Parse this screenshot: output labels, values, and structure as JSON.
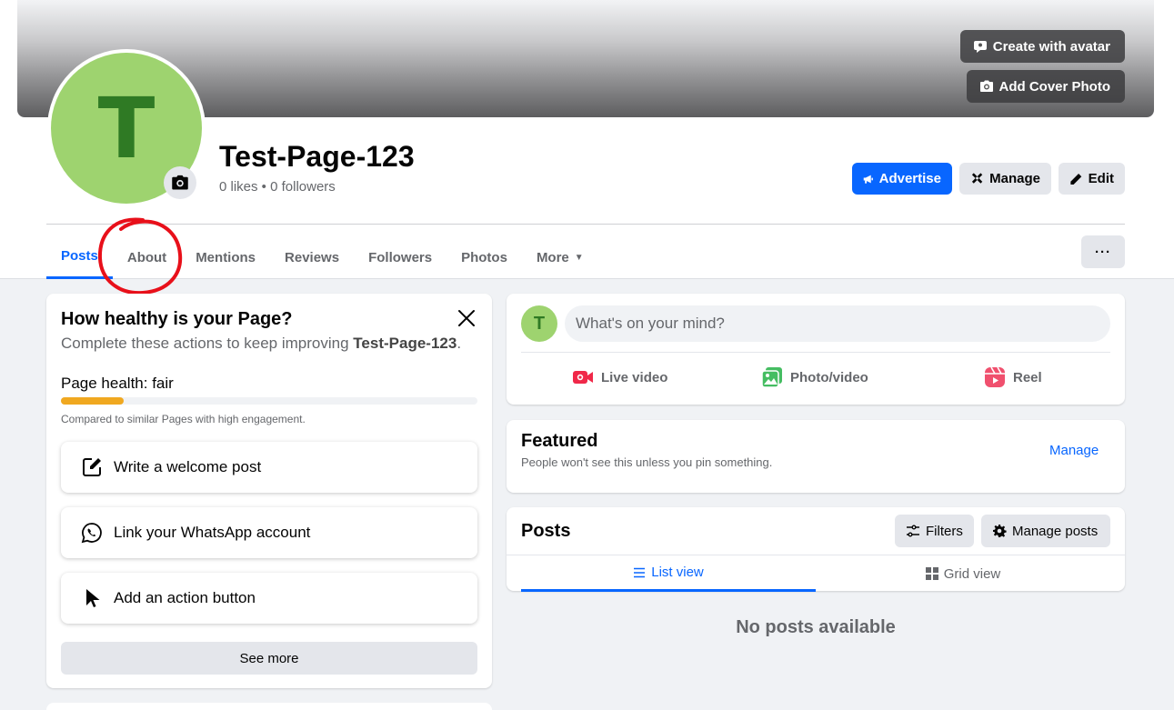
{
  "cover": {
    "create_avatar_label": "Create with avatar",
    "add_cover_label": "Add Cover Photo"
  },
  "profile": {
    "avatar_letter": "T",
    "page_name": "Test-Page-123",
    "stats": "0 likes • 0 followers"
  },
  "actions": {
    "advertise": "Advertise",
    "manage": "Manage",
    "edit": "Edit"
  },
  "tabs": [
    {
      "label": "Posts",
      "active": true
    },
    {
      "label": "About"
    },
    {
      "label": "Mentions"
    },
    {
      "label": "Reviews"
    },
    {
      "label": "Followers"
    },
    {
      "label": "Photos"
    },
    {
      "label": "More"
    }
  ],
  "more_dots": "···",
  "health": {
    "title": "How healthy is your Page?",
    "subtitle_prefix": "Complete these actions to keep improving ",
    "subtitle_page": "Test-Page-123",
    "subtitle_suffix": ".",
    "label": "Page health: fair",
    "progress": 0.15,
    "note": "Compared to similar Pages with high engagement.",
    "tasks": [
      {
        "label": "Write a welcome post",
        "icon": "edit-square-icon"
      },
      {
        "label": "Link your WhatsApp account",
        "icon": "whatsapp-icon"
      },
      {
        "label": "Add an action button",
        "icon": "cursor-icon"
      }
    ],
    "see_more": "See more"
  },
  "composer": {
    "avatar_letter": "T",
    "placeholder": "What's on your mind?",
    "live": "Live video",
    "photo": "Photo/video",
    "reel": "Reel"
  },
  "featured": {
    "title": "Featured",
    "subtitle": "People won't see this unless you pin something.",
    "manage": "Manage"
  },
  "posts": {
    "title": "Posts",
    "filters": "Filters",
    "manage_posts": "Manage posts",
    "list_view": "List view",
    "grid_view": "Grid view",
    "empty": "No posts available"
  },
  "colors": {
    "accent": "#0866ff",
    "avatar_bg": "#9ed36f",
    "avatar_fg": "#2f7a24",
    "health_bar": "#f0a820",
    "annotation": "#e8101a"
  }
}
